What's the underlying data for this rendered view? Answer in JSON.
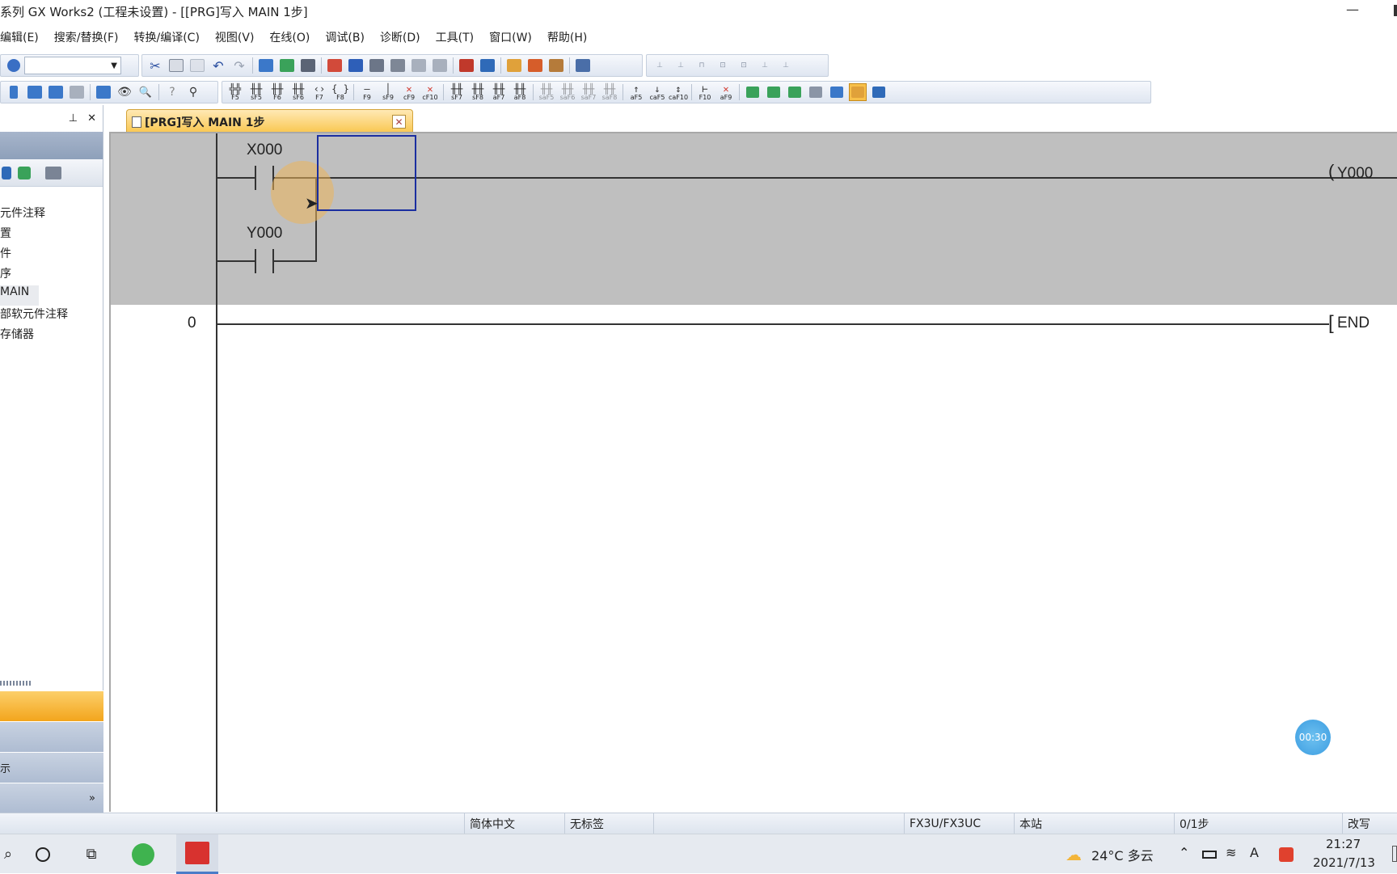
{
  "window": {
    "title": "系列 GX Works2 (工程未设置) - [[PRG]写入 MAIN 1步]",
    "minimize": "—",
    "maximize": ""
  },
  "menu": [
    "编辑(E)",
    "搜索/替换(F)",
    "转换/编译(C)",
    "视图(V)",
    "在线(O)",
    "调试(B)",
    "诊断(D)",
    "工具(T)",
    "窗口(W)",
    "帮助(H)"
  ],
  "ladder_keys": [
    {
      "sym": "╬╬",
      "key": "F5"
    },
    {
      "sym": "╫╫",
      "key": "sF5"
    },
    {
      "sym": "╫╫",
      "key": "F6"
    },
    {
      "sym": "╫╫",
      "key": "sF6"
    },
    {
      "sym": "‹›",
      "key": "F7"
    },
    {
      "sym": "{ }",
      "key": "F8"
    },
    {
      "sym": "—",
      "key": "F9"
    },
    {
      "sym": "│",
      "key": "sF9"
    },
    {
      "sym": "✕",
      "key": "cF9"
    },
    {
      "sym": "✕",
      "key": "cF10"
    },
    {
      "sym": "╫╫",
      "key": "sF7"
    },
    {
      "sym": "╫╫",
      "key": "sF8"
    },
    {
      "sym": "╫╫",
      "key": "aF7"
    },
    {
      "sym": "╫╫",
      "key": "aF8"
    },
    {
      "sym": "╫╫",
      "key": "saF5"
    },
    {
      "sym": "╫╫",
      "key": "saF6"
    },
    {
      "sym": "╫╫",
      "key": "saF7"
    },
    {
      "sym": "╫╫",
      "key": "saF8"
    },
    {
      "sym": "↑",
      "key": "aF5"
    },
    {
      "sym": "↓",
      "key": "caF5"
    },
    {
      "sym": "↕",
      "key": "caF10"
    },
    {
      "sym": "⊢",
      "key": "F10"
    },
    {
      "sym": "✕",
      "key": "aF9"
    }
  ],
  "nav": {
    "pin": "📌",
    "close": "✕",
    "tree": [
      "元件注释",
      "置",
      "件",
      "序",
      "MAIN",
      "部软元件注释",
      "存储器"
    ],
    "selected_index": 4,
    "bottom": [
      "",
      "",
      "示",
      "»"
    ]
  },
  "tab": {
    "label": "[PRG]写入 MAIN 1步",
    "close": "✕"
  },
  "ladder": {
    "contact1": "X000",
    "contact2": "Y000",
    "coil": "Y000",
    "step_end": "0",
    "end_label": "END"
  },
  "timer": "00:30",
  "status": {
    "language": "简体中文",
    "label": "无标签",
    "plc": "FX3U/FX3UC",
    "station": "本站",
    "steps": "0/1步",
    "mode": "改写"
  },
  "taskbar": {
    "weather": "24°C  多云",
    "time": "21:27",
    "date": "2021/7/13",
    "ime": "A"
  }
}
